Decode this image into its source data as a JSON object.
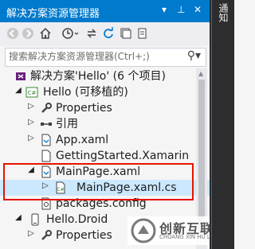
{
  "panel": {
    "title": "解决方案资源管理器",
    "controls": {
      "dropdown": "▾",
      "pin": "⊥",
      "close": "✕"
    }
  },
  "toolbar": {
    "buttons": [
      "back-icon",
      "forward-icon",
      "home-icon",
      "history-icon",
      "sync-icon",
      "refresh-icon",
      "collapse-icon",
      "show-all-files-icon"
    ]
  },
  "search": {
    "placeholder": "搜索解决方案资源管理器(Ctrl+;)"
  },
  "tree": {
    "items": [
      {
        "label": "解决方案'Hello' (6 个项目)",
        "icon": "solution-icon"
      },
      {
        "label": "Hello (可移植的)",
        "icon": "csharp-project-icon"
      },
      {
        "label": "Properties",
        "icon": "wrench-icon"
      },
      {
        "label": "引用",
        "icon": "references-icon"
      },
      {
        "label": "App.xaml",
        "icon": "xaml-file-icon"
      },
      {
        "label": "GettingStarted.Xamarin",
        "icon": "file-icon"
      },
      {
        "label": "MainPage.xaml",
        "icon": "xaml-file-icon"
      },
      {
        "label": "MainPage.xaml.cs",
        "icon": "csharp-file-icon"
      },
      {
        "label": "packages.config",
        "icon": "config-file-icon"
      },
      {
        "label": "Hello.Droid",
        "icon": "android-project-icon"
      },
      {
        "label": "Properties",
        "icon": "wrench-icon"
      }
    ]
  },
  "side_tab": "通知",
  "watermark": {
    "title": "创新互联",
    "subtitle": "CHUANG XIN HU LIAN"
  },
  "colors": {
    "accent": "#007acc",
    "highlight": "#e51400",
    "selection": "#cce8ff"
  }
}
